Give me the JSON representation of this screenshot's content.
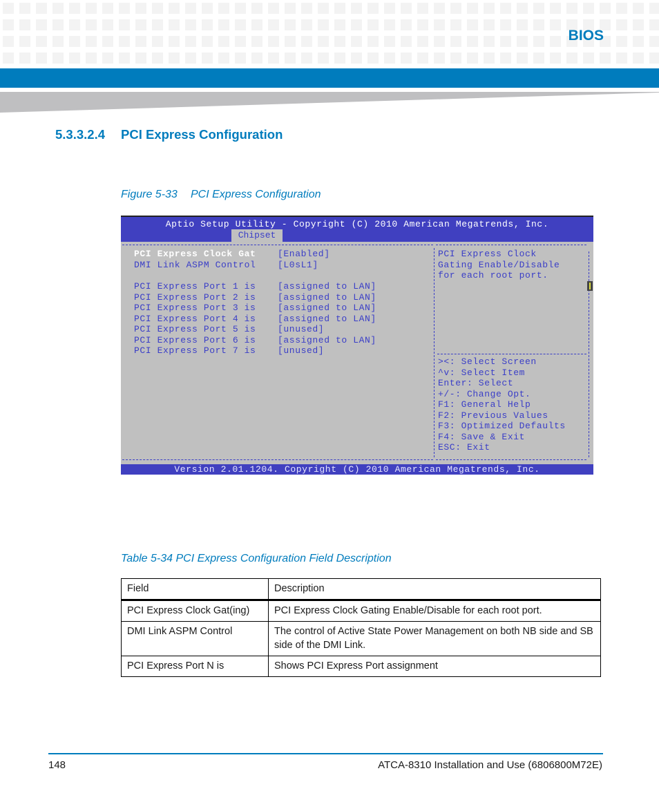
{
  "header": {
    "chapter": "BIOS",
    "colors": {
      "brand_blue": "#007cbd",
      "bios_blue": "#4040c0",
      "bios_gray": "#c0c0c0",
      "bios_text": "#3a3ec7"
    }
  },
  "section": {
    "number": "5.3.3.2.4",
    "title": "PCI Express Configuration"
  },
  "figure": {
    "label": "Figure 5-33",
    "title": "PCI Express Configuration"
  },
  "bios": {
    "title": "Aptio Setup Utility - Copyright (C) 2010 American Megatrends, Inc.",
    "active_tab": "Chipset",
    "settings": [
      {
        "name": "PCI Express Clock Gat",
        "value": "[Enabled]",
        "selected": true
      },
      {
        "name": "DMI Link ASPM Control",
        "value": "[L0sL1]",
        "selected": false
      },
      {
        "name": "PCI Express Port 1 is",
        "value": "[assigned to LAN]",
        "selected": false
      },
      {
        "name": "PCI Express Port 2 is",
        "value": "[assigned to LAN]",
        "selected": false
      },
      {
        "name": "PCI Express Port 3 is",
        "value": "[assigned to LAN]",
        "selected": false
      },
      {
        "name": "PCI Express Port 4 is",
        "value": "[assigned to LAN]",
        "selected": false
      },
      {
        "name": "PCI Express Port 5 is",
        "value": "[unused]",
        "selected": false
      },
      {
        "name": "PCI Express Port 6 is",
        "value": "[assigned to LAN]",
        "selected": false
      },
      {
        "name": "PCI Express Port 7 is",
        "value": "[unused]",
        "selected": false
      }
    ],
    "help_text": [
      "PCI Express Clock",
      "Gating Enable/Disable",
      "for each root port."
    ],
    "key_help": [
      "><: Select Screen",
      "^v: Select Item",
      "Enter: Select",
      "+/-: Change Opt.",
      "F1: General Help",
      "F2: Previous Values",
      "F3: Optimized Defaults",
      "F4: Save & Exit",
      "ESC: Exit"
    ],
    "footer": "Version 2.01.1204. Copyright (C) 2010 American Megatrends, Inc."
  },
  "table": {
    "caption": "Table 5-34 PCI Express Configuration Field Description",
    "headers": [
      "Field",
      "Description"
    ],
    "rows": [
      [
        "PCI Express Clock Gat(ing)",
        "PCI Express Clock Gating Enable/Disable for each root port."
      ],
      [
        "DMI Link ASPM Control",
        "The control of Active State Power Management on both NB side and SB side of the DMI Link."
      ],
      [
        "PCI Express Port N is",
        "Shows PCI Express Port assignment"
      ]
    ]
  },
  "footer": {
    "page_number": "148",
    "document_title": "ATCA-8310 Installation and Use (6806800M72E)"
  }
}
